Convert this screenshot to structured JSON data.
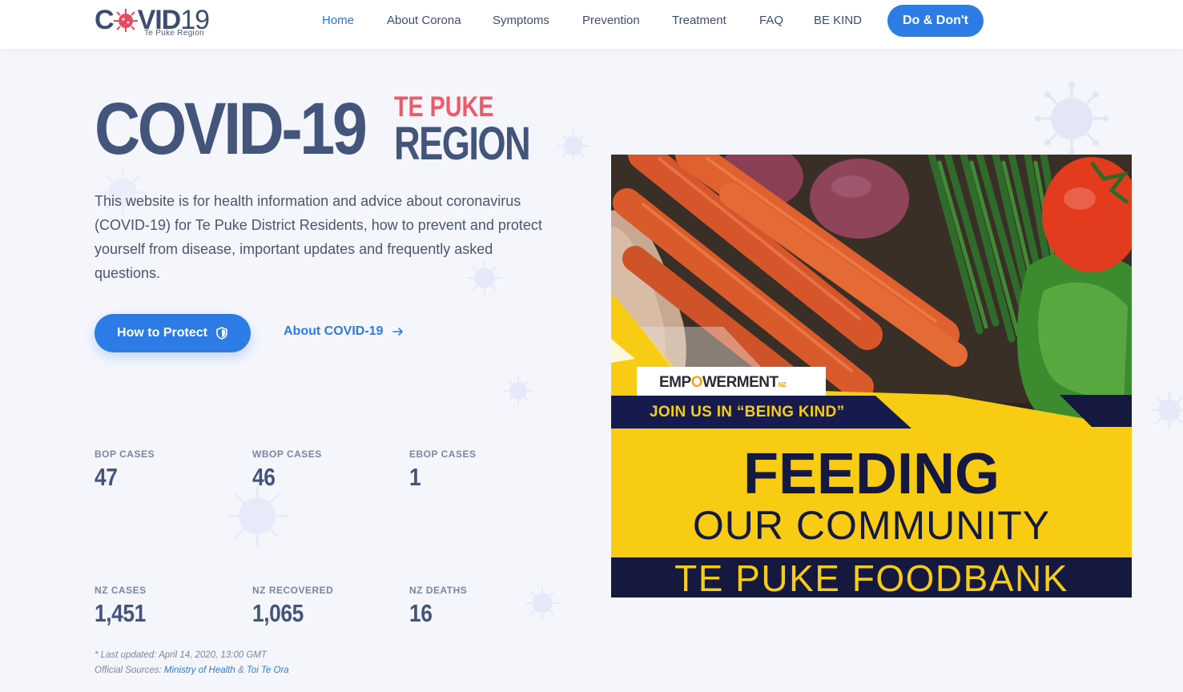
{
  "header": {
    "logo": {
      "title_left": "C",
      "title_right": "VID",
      "title_num": "19",
      "subtitle": "Te Puke Region"
    },
    "nav": [
      {
        "label": "Home",
        "active": true
      },
      {
        "label": "About Corona",
        "active": false
      },
      {
        "label": "Symptoms",
        "active": false
      },
      {
        "label": "Prevention",
        "active": false
      },
      {
        "label": "Treatment",
        "active": false
      },
      {
        "label": "FAQ",
        "active": false
      },
      {
        "label": "BE KIND",
        "active": false
      }
    ],
    "cta_label": "Do & Don't"
  },
  "hero": {
    "title": "COVID-19",
    "tag_line1": "TE PUKE",
    "tag_line2": "REGION",
    "description": "This website is for health information and advice about coronavirus (COVID-19) for Te Puke District Residents, how to prevent and protect yourself from disease, important updates and frequently asked questions.",
    "primary_button": "How to Protect",
    "secondary_link": "About COVID-19"
  },
  "stats": [
    {
      "label": "BOP CASES",
      "value": "47"
    },
    {
      "label": "WBOP CASES",
      "value": "46"
    },
    {
      "label": "EBOP CASES",
      "value": "1"
    },
    {
      "label": "NZ CASES",
      "value": "1,451"
    },
    {
      "label": "NZ RECOVERED",
      "value": "1,065"
    },
    {
      "label": "NZ DEATHS",
      "value": "16"
    }
  ],
  "footnote": {
    "updated": "* Last updated: April 14, 2020, 13:00 GMT",
    "sources_prefix": "Official Sources: ",
    "source1": "Ministry of Health",
    "sources_sep": " & ",
    "source2": "Toi Te Ora"
  },
  "banner": {
    "brand_pre": "EMP",
    "brand_o": "O",
    "brand_post": "WERMENT",
    "brand_suffix": "NZ",
    "tagline": "JOIN US IN “BEING KIND”",
    "headline": "FEEDING",
    "subheadline": "OUR COMMUNITY",
    "footer": "TE PUKE FOODBANK"
  },
  "colors": {
    "primary": "#2d7be5",
    "heading": "#44557c",
    "accent_red": "#ef5a6a",
    "banner_yellow": "#f7cc13",
    "banner_navy": "#15183f"
  }
}
